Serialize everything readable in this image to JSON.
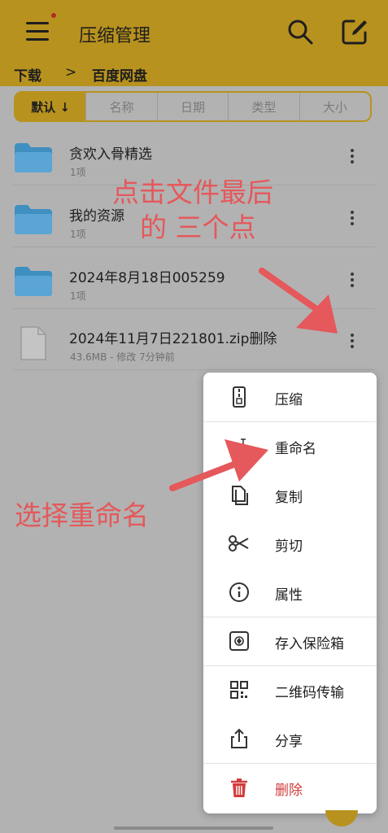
{
  "header": {
    "title": "压缩管理",
    "menu_icon": "hamburger-menu-icon",
    "search_icon": "search-icon",
    "edit_icon": "edit-icon",
    "accent_color": "#b8921e"
  },
  "breadcrumb": {
    "items": [
      "下载",
      "百度网盘"
    ],
    "separator": ">"
  },
  "sort_tabs": [
    {
      "label": "默认 ↓",
      "active": true
    },
    {
      "label": "名称",
      "active": false
    },
    {
      "label": "日期",
      "active": false
    },
    {
      "label": "类型",
      "active": false
    },
    {
      "label": "大小",
      "active": false
    }
  ],
  "files": [
    {
      "name": "贪欢入骨精选",
      "meta": "1项",
      "icon": "folder-icon"
    },
    {
      "name": "我的资源",
      "meta": "1项",
      "icon": "folder-icon"
    },
    {
      "name": "2024年8月18日005259",
      "meta": "1项",
      "icon": "folder-icon"
    },
    {
      "name": "2024年11月7日221801.zip删除",
      "meta": "43.6MB - 修改 7分钟前",
      "icon": "file-icon"
    }
  ],
  "context_menu": {
    "items": [
      {
        "label": "压缩",
        "icon": "zip-icon"
      },
      {
        "label": "重命名",
        "icon": "rename-icon"
      },
      {
        "label": "复制",
        "icon": "copy-icon"
      },
      {
        "label": "剪切",
        "icon": "scissors-icon"
      },
      {
        "label": "属性",
        "icon": "info-icon"
      },
      {
        "label": "存入保险箱",
        "icon": "safe-icon"
      },
      {
        "label": "二维码传输",
        "icon": "qr-code-icon"
      },
      {
        "label": "分享",
        "icon": "share-icon"
      },
      {
        "label": "删除",
        "icon": "trash-icon",
        "danger_color": "#d23b3b"
      }
    ]
  },
  "annotations": {
    "line1": "点击文件最后",
    "line2": "的 三个点",
    "line3": "选择重命名",
    "color": "#e5585b"
  }
}
